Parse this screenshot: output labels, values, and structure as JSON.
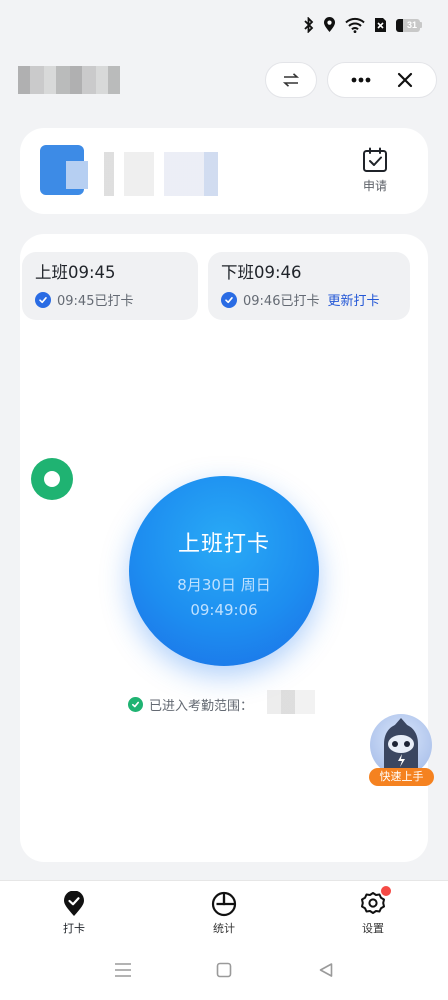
{
  "status_bar": {
    "icons": [
      "bluetooth-icon",
      "location-icon",
      "wifi-icon",
      "sim-off-icon",
      "battery-icon"
    ],
    "battery_level": "31"
  },
  "header": {
    "switch_icon": "swap-arrows-icon",
    "more_icon": "more-dots-icon",
    "close_icon": "close-icon"
  },
  "company_card": {
    "apply_label": "申请",
    "apply_icon": "calendar-check-icon"
  },
  "shifts": [
    {
      "title": "上班09:45",
      "status": "09:45已打卡",
      "action": ""
    },
    {
      "title": "下班09:46",
      "status": "09:46已打卡",
      "action": "更新打卡"
    }
  ],
  "clock_button": {
    "title": "上班打卡",
    "date": "8月30日 周日",
    "time": "09:49:06"
  },
  "range": {
    "text": "已进入考勤范围："
  },
  "quick_start": {
    "label": "快速上手"
  },
  "bottom_nav": {
    "items": [
      {
        "label": "打卡",
        "icon": "checkin-shield-icon",
        "active": true
      },
      {
        "label": "统计",
        "icon": "pie-chart-icon",
        "active": false
      },
      {
        "label": "设置",
        "icon": "gear-icon",
        "active": false,
        "badge": true
      }
    ]
  },
  "system_nav": [
    "menu-icon",
    "home-icon",
    "back-icon"
  ],
  "colors": {
    "accent_blue": "#1d8df0",
    "link_blue": "#2458d6",
    "success_green": "#1fb372",
    "badge_red": "#f54a45",
    "orange": "#f58220"
  }
}
